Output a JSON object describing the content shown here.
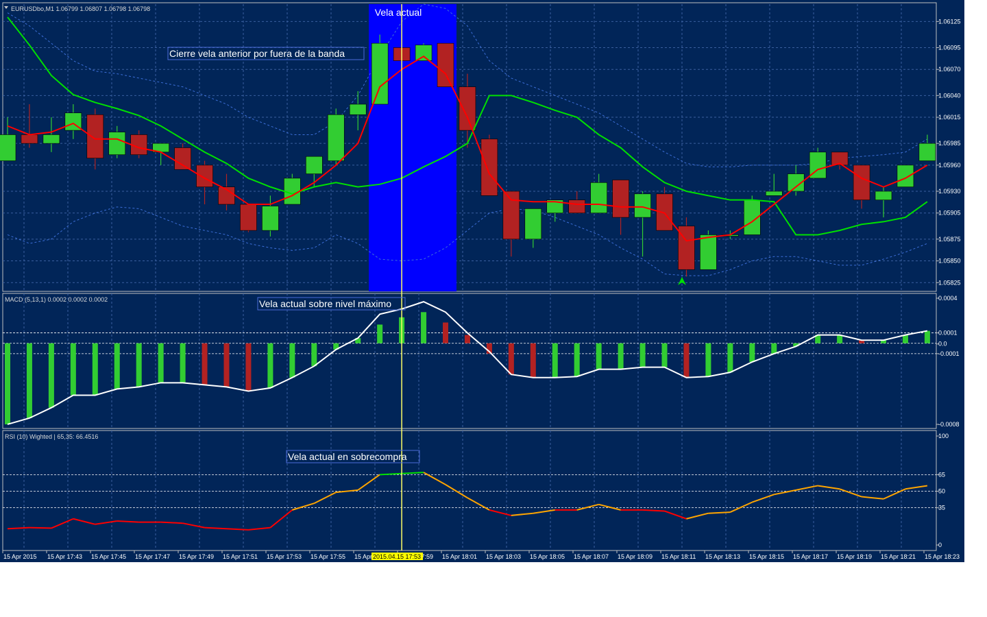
{
  "symbol_header": "EURUSDbo,M1  1.06799 1.06807 1.06798 1.06798",
  "macd_header": "MACD (5,13,1) 0.0002 0.0002 0.0002",
  "rsi_header": "RSI (10) Wighted | 65,35: 66.4516",
  "annotations": {
    "current_candle": "Vela actual",
    "prev_close_outside": "Cierre vela anterior por fuera de la banda",
    "macd_max": "Vela actual sobre nivel máximo",
    "rsi_overbought": "Vela actual en sobrecompra"
  },
  "time_cursor": "2015.04.15 17:53",
  "time_labels": [
    "15 Apr 2015",
    "15 Apr 17:43",
    "15 Apr 17:45",
    "15 Apr 17:47",
    "15 Apr 17:49",
    "15 Apr 17:51",
    "15 Apr 17:53",
    "15 Apr 17:55",
    "15 Apr 17:57",
    "15 Apr 17:59",
    "15 Apr 18:01",
    "15 Apr 18:03",
    "15 Apr 18:05",
    "15 Apr 18:07",
    "15 Apr 18:09",
    "15 Apr 18:11",
    "15 Apr 18:13",
    "15 Apr 18:15",
    "15 Apr 18:17",
    "15 Apr 18:19",
    "15 Apr 18:21",
    "15 Apr 18:23"
  ],
  "colors": {
    "background": "#012558",
    "bull": "#32cd32",
    "bear": "#b22222",
    "ma_red": "#ff0000",
    "ma_green": "#00e000",
    "highlight": "#0000ff",
    "cursor": "#ffff66",
    "macd_signal": "#ffffff",
    "rsi_low": "#ff0000",
    "rsi_mid": "#ffa500",
    "rsi_high": "#00e000"
  },
  "chart_data": [
    {
      "type": "candlestick",
      "title": "EURUSDbo,M1",
      "ylim": [
        1.05815,
        1.06145
      ],
      "y_ticks": [
        "1.06125",
        "1.06095",
        "1.06070",
        "1.06040",
        "1.06015",
        "1.05985",
        "1.05960",
        "1.05930",
        "1.05905",
        "1.05875",
        "1.05850",
        "1.05825"
      ],
      "candles": [
        {
          "o": 1.05965,
          "h": 1.06015,
          "l": 1.05965,
          "c": 1.05995
        },
        {
          "o": 1.05995,
          "h": 1.0603,
          "l": 1.0598,
          "c": 1.05985
        },
        {
          "o": 1.05985,
          "h": 1.06015,
          "l": 1.05975,
          "c": 1.05995
        },
        {
          "o": 1.06,
          "h": 1.0603,
          "l": 1.0599,
          "c": 1.0602
        },
        {
          "o": 1.06018,
          "h": 1.06025,
          "l": 1.05955,
          "c": 1.05968
        },
        {
          "o": 1.05972,
          "h": 1.06005,
          "l": 1.05968,
          "c": 1.05998
        },
        {
          "o": 1.05995,
          "h": 1.06,
          "l": 1.05968,
          "c": 1.05972
        },
        {
          "o": 1.05975,
          "h": 1.05985,
          "l": 1.0596,
          "c": 1.05985
        },
        {
          "o": 1.0598,
          "h": 1.05985,
          "l": 1.05955,
          "c": 1.05955
        },
        {
          "o": 1.0596,
          "h": 1.05965,
          "l": 1.05915,
          "c": 1.05935
        },
        {
          "o": 1.05935,
          "h": 1.0595,
          "l": 1.05908,
          "c": 1.05915
        },
        {
          "o": 1.05915,
          "h": 1.05915,
          "l": 1.05883,
          "c": 1.05885
        },
        {
          "o": 1.05885,
          "h": 1.05925,
          "l": 1.05878,
          "c": 1.05913
        },
        {
          "o": 1.05915,
          "h": 1.0595,
          "l": 1.05915,
          "c": 1.05945
        },
        {
          "o": 1.0595,
          "h": 1.0597,
          "l": 1.05935,
          "c": 1.0597
        },
        {
          "o": 1.05965,
          "h": 1.06025,
          "l": 1.0596,
          "c": 1.06018
        },
        {
          "o": 1.06018,
          "h": 1.06045,
          "l": 1.06,
          "c": 1.0603
        },
        {
          "o": 1.0603,
          "h": 1.0611,
          "l": 1.0603,
          "c": 1.061
        },
        {
          "o": 1.06095,
          "h": 1.06105,
          "l": 1.0608,
          "c": 1.0608
        },
        {
          "o": 1.0608,
          "h": 1.061,
          "l": 1.0608,
          "c": 1.06098
        },
        {
          "o": 1.061,
          "h": 1.061,
          "l": 1.0605,
          "c": 1.0605
        },
        {
          "o": 1.0605,
          "h": 1.06065,
          "l": 1.0598,
          "c": 1.06
        },
        {
          "o": 1.0599,
          "h": 1.05995,
          "l": 1.05925,
          "c": 1.05925
        },
        {
          "o": 1.0593,
          "h": 1.0593,
          "l": 1.05855,
          "c": 1.05875
        },
        {
          "o": 1.05875,
          "h": 1.0591,
          "l": 1.05865,
          "c": 1.0591
        },
        {
          "o": 1.05905,
          "h": 1.0592,
          "l": 1.05895,
          "c": 1.0592
        },
        {
          "o": 1.0592,
          "h": 1.0593,
          "l": 1.05905,
          "c": 1.05905
        },
        {
          "o": 1.05905,
          "h": 1.0595,
          "l": 1.05905,
          "c": 1.0594
        },
        {
          "o": 1.05943,
          "h": 1.05943,
          "l": 1.0588,
          "c": 1.059
        },
        {
          "o": 1.059,
          "h": 1.0593,
          "l": 1.05855,
          "c": 1.05927
        },
        {
          "o": 1.05927,
          "h": 1.05935,
          "l": 1.05885,
          "c": 1.05885
        },
        {
          "o": 1.0589,
          "h": 1.059,
          "l": 1.05832,
          "c": 1.0584
        },
        {
          "o": 1.0584,
          "h": 1.05885,
          "l": 1.0584,
          "c": 1.0588
        },
        {
          "o": 1.0588,
          "h": 1.05885,
          "l": 1.05875,
          "c": 1.0588
        },
        {
          "o": 1.0588,
          "h": 1.05925,
          "l": 1.0588,
          "c": 1.0592
        },
        {
          "o": 1.05925,
          "h": 1.0595,
          "l": 1.05925,
          "c": 1.0593
        },
        {
          "o": 1.0593,
          "h": 1.0596,
          "l": 1.05925,
          "c": 1.0595
        },
        {
          "o": 1.05945,
          "h": 1.0598,
          "l": 1.05945,
          "c": 1.05975
        },
        {
          "o": 1.05975,
          "h": 1.05975,
          "l": 1.05955,
          "c": 1.0596
        },
        {
          "o": 1.0596,
          "h": 1.0596,
          "l": 1.0591,
          "c": 1.0592
        },
        {
          "o": 1.0592,
          "h": 1.05935,
          "l": 1.059,
          "c": 1.0593
        },
        {
          "o": 1.05935,
          "h": 1.0596,
          "l": 1.05935,
          "c": 1.0596
        },
        {
          "o": 1.05965,
          "h": 1.05995,
          "l": 1.05965,
          "c": 1.05985
        }
      ],
      "ma_fast": [
        1.06005,
        1.05995,
        1.05998,
        1.06008,
        1.0599,
        1.0599,
        1.0598,
        1.05975,
        1.0596,
        1.05945,
        1.05932,
        1.05915,
        1.05915,
        1.05925,
        1.0594,
        1.0596,
        1.05985,
        1.0605,
        1.0607,
        1.06085,
        1.06065,
        1.06015,
        1.0595,
        1.0592,
        1.05918,
        1.05918,
        1.05915,
        1.05915,
        1.05912,
        1.05912,
        1.05905,
        1.05873,
        1.05877,
        1.0588,
        1.05895,
        1.05915,
        1.05935,
        1.05955,
        1.05962,
        1.05945,
        1.05935,
        1.05945,
        1.0596
      ],
      "ma_slow": [
        1.0613,
        1.06098,
        1.06063,
        1.06041,
        1.06032,
        1.06025,
        1.06017,
        1.06005,
        1.0599,
        1.05975,
        1.05962,
        1.05945,
        1.05935,
        1.05927,
        1.05935,
        1.0594,
        1.05935,
        1.05938,
        1.05945,
        1.05958,
        1.0597,
        1.05985,
        1.0604,
        1.0604,
        1.06032,
        1.06023,
        1.06015,
        1.05995,
        1.0598,
        1.05958,
        1.0594,
        1.0593,
        1.05925,
        1.0592,
        1.0592,
        1.05918,
        1.0588,
        1.0588,
        1.05885,
        1.05892,
        1.05895,
        1.059,
        1.05918
      ],
      "band_upper": [
        1.06135,
        1.0612,
        1.061,
        1.0608,
        1.06068,
        1.06065,
        1.0606,
        1.06055,
        1.0605,
        1.0604,
        1.0603,
        1.06015,
        1.06005,
        1.05995,
        1.05995,
        1.0601,
        1.0604,
        1.06085,
        1.06125,
        1.06145,
        1.0614,
        1.0612,
        1.0608,
        1.0606,
        1.0605,
        1.0604,
        1.0603,
        1.0602,
        1.06005,
        1.0599,
        1.05975,
        1.05962,
        1.05958,
        1.05958,
        1.0596,
        1.0596,
        1.0596,
        1.05962,
        1.05968,
        1.0597,
        1.05972,
        1.05975,
        1.0599
      ],
      "band_lower": [
        1.0588,
        1.0587,
        1.05875,
        1.05895,
        1.05905,
        1.05912,
        1.0591,
        1.059,
        1.0589,
        1.05885,
        1.0588,
        1.0587,
        1.05865,
        1.05862,
        1.05865,
        1.0588,
        1.0587,
        1.05852,
        1.0585,
        1.05852,
        1.05865,
        1.05885,
        1.05905,
        1.0591,
        1.05908,
        1.059,
        1.0589,
        1.0588,
        1.05865,
        1.05852,
        1.05835,
        1.05833,
        1.05833,
        1.0584,
        1.0585,
        1.05855,
        1.05855,
        1.0585,
        1.05845,
        1.05845,
        1.05852,
        1.0586,
        1.0587
      ],
      "highlight_range": [
        17,
        20
      ],
      "cursor_index": 18
    },
    {
      "type": "bar+line",
      "title": "MACD (5,13,1)",
      "ylim": [
        -0.00082,
        0.00048
      ],
      "y_ticks": [
        "0.0004",
        "0.0001",
        "0.0",
        "-0.0001",
        "-0.0008"
      ],
      "levels": [
        0.0001,
        0.0,
        -0.0001
      ],
      "histogram": [
        -0.00078,
        -0.00072,
        -0.00062,
        -0.0005,
        -0.0005,
        -0.00044,
        -0.00042,
        -0.00038,
        -0.00038,
        -0.0004,
        -0.00042,
        -0.00046,
        -0.00043,
        -0.00033,
        -0.00022,
        -6e-05,
        5e-05,
        0.00018,
        0.00025,
        0.0003,
        0.0002,
        8e-05,
        -0.0001,
        -0.0003,
        -0.00033,
        -0.00033,
        -0.00032,
        -0.00025,
        -0.00025,
        -0.00023,
        -0.00023,
        -0.00033,
        -0.00032,
        -0.00028,
        -0.00018,
        -0.0001,
        -3e-05,
        8e-05,
        8e-05,
        3e-05,
        3e-05,
        8e-05,
        0.00012
      ],
      "signal": [
        -0.00078,
        -0.00072,
        -0.00062,
        -0.0005,
        -0.0005,
        -0.00044,
        -0.00042,
        -0.00038,
        -0.00038,
        -0.0004,
        -0.00042,
        -0.00046,
        -0.00043,
        -0.00033,
        -0.00022,
        -6e-05,
        5e-05,
        0.00028,
        0.00033,
        0.0004,
        0.0003,
        0.0001,
        -8e-05,
        -0.0003,
        -0.00033,
        -0.00033,
        -0.00032,
        -0.00025,
        -0.00025,
        -0.00023,
        -0.00023,
        -0.00033,
        -0.00032,
        -0.00028,
        -0.00018,
        -0.0001,
        -3e-05,
        8e-05,
        8e-05,
        3e-05,
        3e-05,
        8e-05,
        0.00012
      ]
    },
    {
      "type": "line",
      "title": "RSI (10) Wighted",
      "ylim": [
        0,
        100
      ],
      "y_ticks": [
        "100",
        "65",
        "50",
        "35",
        "0"
      ],
      "levels": [
        65,
        50,
        35
      ],
      "values": [
        16,
        17,
        16.5,
        25,
        20,
        23,
        22,
        22,
        21,
        17,
        16,
        15,
        17,
        33,
        39,
        49,
        51,
        65,
        66,
        67,
        56,
        44,
        33,
        28,
        30,
        33,
        33,
        38,
        33,
        33,
        32,
        25,
        30,
        31,
        40,
        47,
        51,
        55,
        52,
        45,
        43,
        52,
        55
      ]
    }
  ]
}
